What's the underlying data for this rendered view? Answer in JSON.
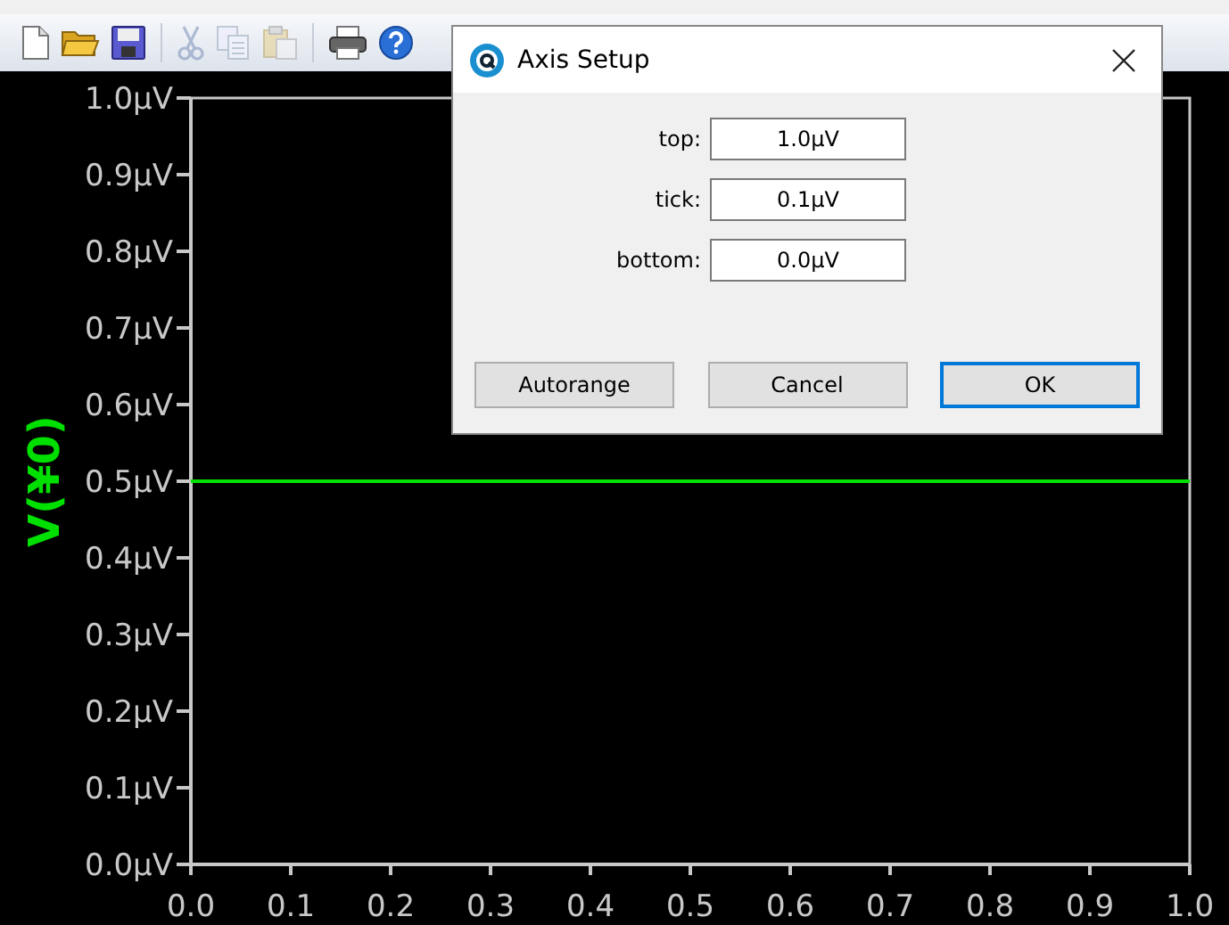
{
  "toolbar": [
    {
      "kind": "new",
      "disabled": false
    },
    {
      "kind": "open",
      "disabled": false
    },
    {
      "kind": "save",
      "disabled": false
    },
    {
      "kind": "cut",
      "disabled": true
    },
    {
      "kind": "copy",
      "disabled": true
    },
    {
      "kind": "paste",
      "disabled": true
    },
    {
      "kind": "print",
      "disabled": false
    },
    {
      "kind": "help",
      "disabled": false
    }
  ],
  "plot": {
    "chart_data": {
      "type": "line",
      "ylabel": "V(¥0)",
      "x": [
        0,
        1
      ],
      "series": [
        {
          "color": "#00e000",
          "values": [
            0.5,
            0.5
          ]
        }
      ],
      "xlim": [
        0,
        1
      ],
      "ylim": [
        0,
        1
      ],
      "xticks": [
        {
          "value": 0,
          "label": "0.0"
        },
        {
          "value": 0.1,
          "label": "0.1"
        },
        {
          "value": 0.2,
          "label": "0.2"
        },
        {
          "value": 0.3,
          "label": "0.3"
        },
        {
          "value": 0.4,
          "label": "0.4"
        },
        {
          "value": 0.5,
          "label": "0.5"
        },
        {
          "value": 0.6,
          "label": "0.6"
        },
        {
          "value": 0.7,
          "label": "0.7"
        },
        {
          "value": 0.8,
          "label": "0.8"
        },
        {
          "value": 0.9,
          "label": "0.9"
        },
        {
          "value": 1,
          "label": "1.0"
        }
      ],
      "yticks": [
        {
          "value": 0,
          "label": "0.0µV"
        },
        {
          "value": 0.1,
          "label": "0.1µV"
        },
        {
          "value": 0.2,
          "label": "0.2µV"
        },
        {
          "value": 0.3,
          "label": "0.3µV"
        },
        {
          "value": 0.4,
          "label": "0.4µV"
        },
        {
          "value": 0.5,
          "label": "0.5µV"
        },
        {
          "value": 0.6,
          "label": "0.6µV"
        },
        {
          "value": 0.7,
          "label": "0.7µV"
        },
        {
          "value": 0.8,
          "label": "0.8µV"
        },
        {
          "value": 0.9,
          "label": "0.9µV"
        },
        {
          "value": 1,
          "label": "1.0µV"
        }
      ]
    }
  },
  "dialog": {
    "title": "Axis Setup",
    "fields": [
      {
        "label": "top:",
        "value": "1.0µV"
      },
      {
        "label": "tick:",
        "value": "0.1µV"
      },
      {
        "label": "bottom:",
        "value": "0.0µV"
      }
    ],
    "buttons": [
      {
        "label": "Autorange",
        "default": false
      },
      {
        "label": "Cancel",
        "default": false
      },
      {
        "label": "OK",
        "default": true
      }
    ]
  }
}
